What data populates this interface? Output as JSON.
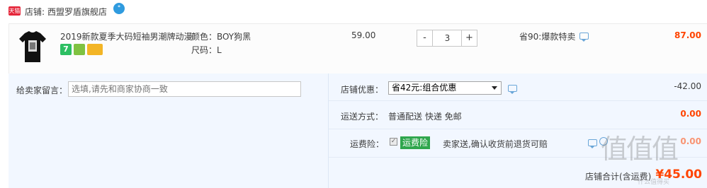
{
  "shop": {
    "badge": "天猫",
    "label": "店铺:",
    "name": "西盟罗盾旗舰店"
  },
  "item": {
    "title": "2019新款夏季大码短袖男潮牌动漫T恤",
    "sku_color": "颜色：BOY狗黑",
    "sku_size": "尺码：L",
    "price": "59.00",
    "quantity": "3",
    "minus": "-",
    "plus": "+",
    "promo": "省90:爆款特卖",
    "subtotal": "87.00",
    "service_icon": "7"
  },
  "message": {
    "label": "给卖家留言：",
    "placeholder": "选填,请先和商家协商一致"
  },
  "coupon": {
    "label": "店铺优惠：",
    "selected": "省42元:组合优惠",
    "discount": "-42.00"
  },
  "shipping": {
    "label": "运送方式：",
    "value": "普通配送 快递 免邮",
    "fee": "0.00"
  },
  "insurance": {
    "label": "运费险：",
    "tag": "运费险",
    "text": "卖家送,确认收货前退货可赔",
    "fee": "0.00"
  },
  "total": {
    "label": "店铺合计(含运费)",
    "value": "¥45.00"
  },
  "watermark": {
    "text": "值值值",
    "sub": "什么值得买"
  },
  "colors": {
    "accent": "#ff4400",
    "tmall_red": "#e5273b",
    "panel_bg": "#f2f7ff",
    "insurance_green": "#2fa64d"
  }
}
